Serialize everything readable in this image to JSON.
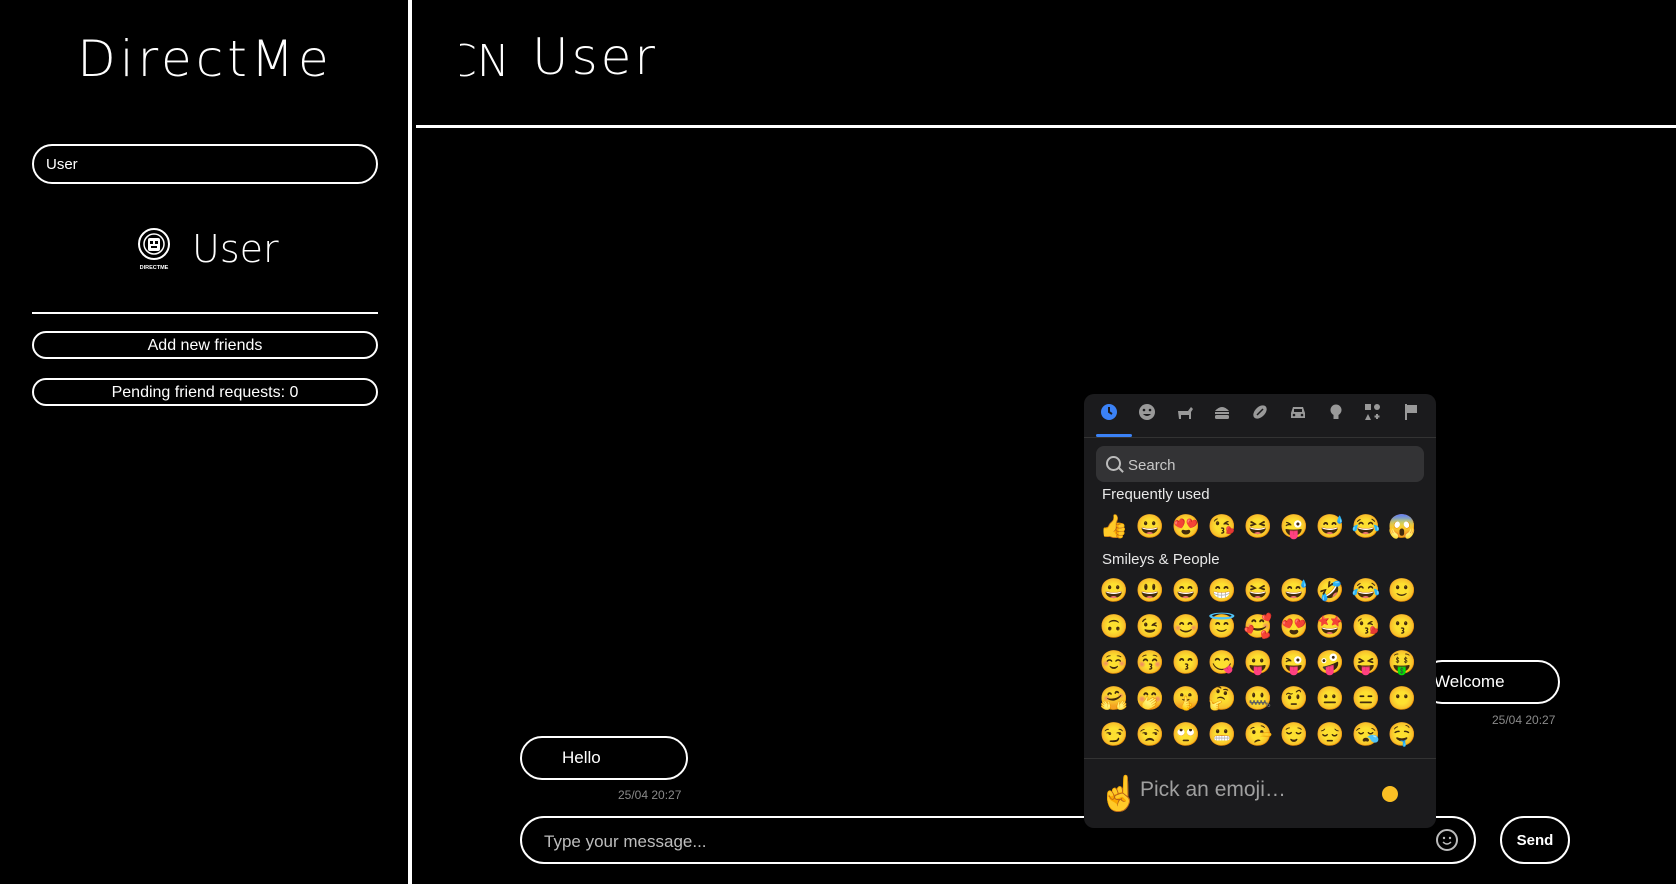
{
  "sidebar": {
    "app_title": "DirectMe",
    "search_value": "User",
    "user_name": "User",
    "logo_text": "DIRECTME",
    "add_friends_label": "Add new friends",
    "pending_label": "Pending friend requests: 0"
  },
  "chat": {
    "header_avatar_text": "CN",
    "header_name": "User",
    "messages": [
      {
        "text": "Hello",
        "time": "25/04 20:27"
      },
      {
        "text": "Welcome",
        "time": "25/04 20:27"
      }
    ],
    "input_placeholder": "Type your message...",
    "send_label": "Send"
  },
  "emoji_picker": {
    "categories": [
      "clock-icon",
      "smiley-icon",
      "animal-icon",
      "food-icon",
      "activity-icon",
      "car-icon",
      "lightbulb-icon",
      "symbols-icon",
      "flag-icon"
    ],
    "active_category_color": "#3b82f6",
    "search_placeholder": "Search",
    "frequent_label": "Frequently used",
    "frequent": [
      "👍",
      "😀",
      "😍",
      "😘",
      "😆",
      "😜",
      "😅",
      "😂",
      "😱"
    ],
    "smileys_label": "Smileys & People",
    "smileys": [
      [
        "😀",
        "😃",
        "😄",
        "😁",
        "😆",
        "😅",
        "🤣",
        "😂",
        "🙂"
      ],
      [
        "🙃",
        "😉",
        "😊",
        "😇",
        "🥰",
        "😍",
        "🤩",
        "😘",
        "😗"
      ],
      [
        "☺️",
        "😚",
        "😙",
        "😋",
        "😛",
        "😜",
        "🤪",
        "😝",
        "🤑"
      ],
      [
        "🤗",
        "🤭",
        "🤫",
        "🤔",
        "🤐",
        "🤨",
        "😐",
        "😑",
        "😶"
      ],
      [
        "😏",
        "😒",
        "🙄",
        "😬",
        "🤥",
        "😌",
        "😔",
        "😪",
        "🤤"
      ]
    ],
    "preview_emoji": "☝️",
    "preview_placeholder": "Pick an emoji…",
    "skin_tone_color": "#fbbf24"
  }
}
